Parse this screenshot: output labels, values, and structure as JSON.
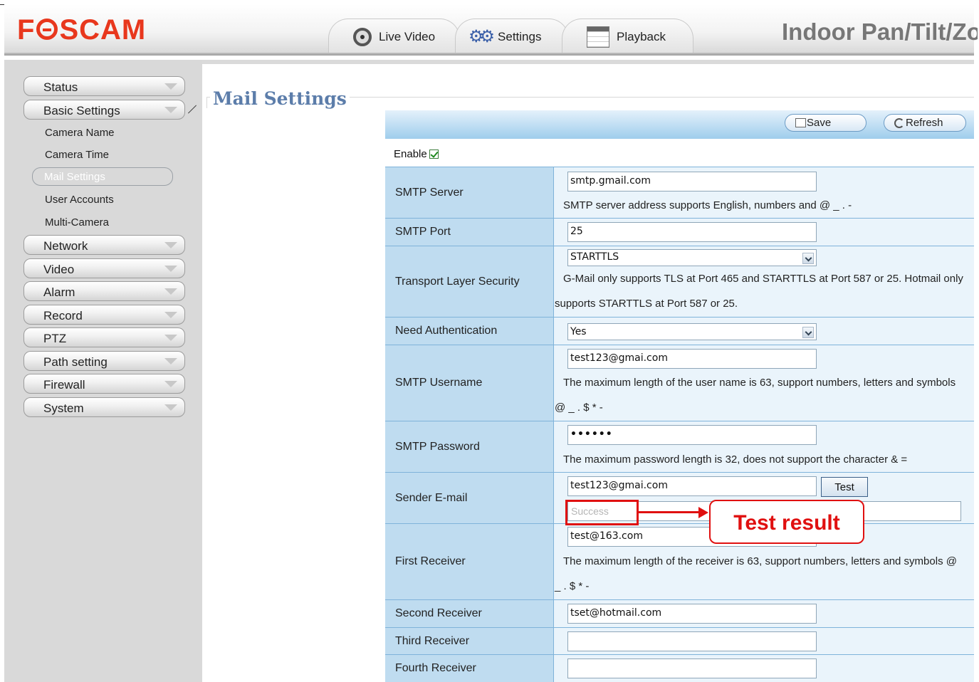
{
  "brand": {
    "logo_pre": "F",
    "logo_post": "SCAM",
    "product": "Indoor Pan/Tilt/Zoom"
  },
  "tabs": [
    {
      "label": "Live Video",
      "icon": "webcam-icon"
    },
    {
      "label": "Settings",
      "icon": "gears-icon"
    },
    {
      "label": "Playback",
      "icon": "calendar-icon"
    }
  ],
  "sidebar": {
    "status": "Status",
    "basic_settings": "Basic Settings",
    "sub_items": [
      "Camera Name",
      "Camera Time",
      "Mail Settings",
      "User Accounts",
      "Multi-Camera"
    ],
    "network": "Network",
    "video": "Video",
    "alarm": "Alarm",
    "record": "Record",
    "ptz": "PTZ",
    "path_setting": "Path setting",
    "firewall": "Firewall",
    "system": "System"
  },
  "page": {
    "title": "Mail Settings",
    "save": "Save",
    "refresh": "Refresh",
    "enable_label": "Enable",
    "enable_checked": true
  },
  "form": {
    "smtp_server": {
      "label": "SMTP Server",
      "value": "smtp.gmail.com",
      "hint": "SMTP server address supports English, numbers and @ _ . -"
    },
    "smtp_port": {
      "label": "SMTP Port",
      "value": "25"
    },
    "tls": {
      "label": "Transport Layer Security",
      "value": "STARTTLS",
      "hint1": "G-Mail only supports TLS at Port 465 and STARTTLS at Port 587 or 25. Hotmail only",
      "hint2": "supports STARTTLS at Port 587 or 25."
    },
    "auth": {
      "label": "Need Authentication",
      "value": "Yes"
    },
    "username": {
      "label": "SMTP Username",
      "value": "test123@gmai.com",
      "hint1": "The maximum length of the user name is 63, support numbers, letters and symbols",
      "hint2": "@ _ . $ * -"
    },
    "password": {
      "label": "SMTP Password",
      "value": "••••••",
      "hint": "The maximum password length is 32, does not support the character & ="
    },
    "sender": {
      "label": "Sender E-mail",
      "value": "test123@gmai.com",
      "test": "Test",
      "result": "Success"
    },
    "first": {
      "label": "First Receiver",
      "value": "test@163.com",
      "hint1": "The maximum length of the receiver is 63, support numbers, letters and symbols @",
      "hint2": "_ . $ * -"
    },
    "second": {
      "label": "Second Receiver",
      "value": "tset@hotmail.com"
    },
    "third": {
      "label": "Third Receiver",
      "value": ""
    },
    "fourth": {
      "label": "Fourth Receiver",
      "value": ""
    }
  },
  "annotation": {
    "callout": "Test result"
  },
  "colors": {
    "brand": "#e8371d",
    "title": "#5c7daa",
    "label_bg": "#bfdcf0",
    "value_bg": "#eaf4fb",
    "annotation": "#e01010"
  }
}
